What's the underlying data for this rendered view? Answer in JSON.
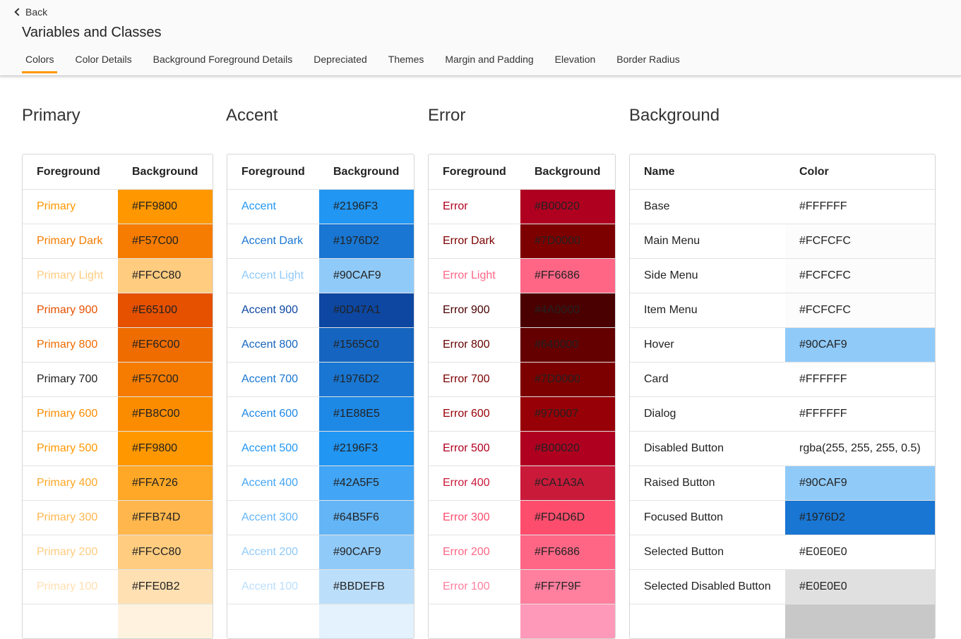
{
  "back_label": "Back",
  "page_title": "Variables and Classes",
  "tabs": [
    "Colors",
    "Color Details",
    "Background Foreground Details",
    "Depreciated",
    "Themes",
    "Margin and Padding",
    "Elevation",
    "Border Radius"
  ],
  "active_tab": "Colors",
  "tables": [
    {
      "id": "primary",
      "title": "Primary",
      "headers": [
        "Foreground",
        "Background"
      ],
      "rows": [
        {
          "name": "Primary",
          "value": "#FF9800",
          "name_color": "#FF9800",
          "bg": "#FF9800",
          "value_color": "#222222"
        },
        {
          "name": "Primary Dark",
          "value": "#F57C00",
          "name_color": "#F57C00",
          "bg": "#F57C00",
          "value_color": "#222222"
        },
        {
          "name": "Primary Light",
          "value": "#FFCC80",
          "name_color": "#FFCC80",
          "bg": "#FFCC80",
          "value_color": "#222222"
        },
        {
          "name": "Primary 900",
          "value": "#E65100",
          "name_color": "#E65100",
          "bg": "#E65100",
          "value_color": "#222222"
        },
        {
          "name": "Primary 800",
          "value": "#EF6C00",
          "name_color": "#EF6C00",
          "bg": "#EF6C00",
          "value_color": "#222222"
        },
        {
          "name": "Primary 700",
          "value": "#F57C00",
          "name_color": "#222222",
          "bg": "#F57C00",
          "value_color": "#222222"
        },
        {
          "name": "Primary 600",
          "value": "#FB8C00",
          "name_color": "#FB8C00",
          "bg": "#FB8C00",
          "value_color": "#222222"
        },
        {
          "name": "Primary 500",
          "value": "#FF9800",
          "name_color": "#FF9800",
          "bg": "#FF9800",
          "value_color": "#222222"
        },
        {
          "name": "Primary 400",
          "value": "#FFA726",
          "name_color": "#FFA726",
          "bg": "#FFA726",
          "value_color": "#222222"
        },
        {
          "name": "Primary 300",
          "value": "#FFB74D",
          "name_color": "#FFB74D",
          "bg": "#FFB74D",
          "value_color": "#222222"
        },
        {
          "name": "Primary 200",
          "value": "#FFCC80",
          "name_color": "#FFCC80",
          "bg": "#FFCC80",
          "value_color": "#222222"
        },
        {
          "name": "Primary 100",
          "value": "#FFE0B2",
          "name_color": "#FFE0B2",
          "bg": "#FFE0B2",
          "value_color": "#222222"
        },
        {
          "name": "",
          "value": "",
          "name_color": "#FFF3E0",
          "bg": "#FFF3E0",
          "value_color": "#222222"
        }
      ]
    },
    {
      "id": "accent",
      "title": "Accent",
      "headers": [
        "Foreground",
        "Background"
      ],
      "rows": [
        {
          "name": "Accent",
          "value": "#2196F3",
          "name_color": "#2196F3",
          "bg": "#2196F3",
          "value_color": "#222222"
        },
        {
          "name": "Accent Dark",
          "value": "#1976D2",
          "name_color": "#1976D2",
          "bg": "#1976D2",
          "value_color": "#222222"
        },
        {
          "name": "Accent Light",
          "value": "#90CAF9",
          "name_color": "#90CAF9",
          "bg": "#90CAF9",
          "value_color": "#222222"
        },
        {
          "name": "Accent 900",
          "value": "#0D47A1",
          "name_color": "#0D47A1",
          "bg": "#0D47A1",
          "value_color": "#222222"
        },
        {
          "name": "Accent 800",
          "value": "#1565C0",
          "name_color": "#1565C0",
          "bg": "#1565C0",
          "value_color": "#222222"
        },
        {
          "name": "Accent 700",
          "value": "#1976D2",
          "name_color": "#1976D2",
          "bg": "#1976D2",
          "value_color": "#222222"
        },
        {
          "name": "Accent 600",
          "value": "#1E88E5",
          "name_color": "#1E88E5",
          "bg": "#1E88E5",
          "value_color": "#222222"
        },
        {
          "name": "Accent 500",
          "value": "#2196F3",
          "name_color": "#2196F3",
          "bg": "#2196F3",
          "value_color": "#222222"
        },
        {
          "name": "Accent 400",
          "value": "#42A5F5",
          "name_color": "#42A5F5",
          "bg": "#42A5F5",
          "value_color": "#222222"
        },
        {
          "name": "Accent 300",
          "value": "#64B5F6",
          "name_color": "#64B5F6",
          "bg": "#64B5F6",
          "value_color": "#222222"
        },
        {
          "name": "Accent 200",
          "value": "#90CAF9",
          "name_color": "#90CAF9",
          "bg": "#90CAF9",
          "value_color": "#222222"
        },
        {
          "name": "Accent 100",
          "value": "#BBDEFB",
          "name_color": "#BBDEFB",
          "bg": "#BBDEFB",
          "value_color": "#222222"
        },
        {
          "name": "",
          "value": "",
          "name_color": "#E3F2FD",
          "bg": "#E3F2FD",
          "value_color": "#222222"
        }
      ]
    },
    {
      "id": "error",
      "title": "Error",
      "headers": [
        "Foreground",
        "Background"
      ],
      "rows": [
        {
          "name": "Error",
          "value": "#B00020",
          "name_color": "#B00020",
          "bg": "#B00020",
          "value_color": "#222222"
        },
        {
          "name": "Error Dark",
          "value": "#7D0000",
          "name_color": "#7D0000",
          "bg": "#7D0000",
          "value_color": "#222222"
        },
        {
          "name": "Error Light",
          "value": "#FF6686",
          "name_color": "#FF6686",
          "bg": "#FF6686",
          "value_color": "#222222"
        },
        {
          "name": "Error 900",
          "value": "#4A0000",
          "name_color": "#4A0000",
          "bg": "#4A0000",
          "value_color": "#222222"
        },
        {
          "name": "Error 800",
          "value": "#640000",
          "name_color": "#640000",
          "bg": "#640000",
          "value_color": "#222222"
        },
        {
          "name": "Error 700",
          "value": "#7D0000",
          "name_color": "#7D0000",
          "bg": "#7D0000",
          "value_color": "#222222"
        },
        {
          "name": "Error 600",
          "value": "#970007",
          "name_color": "#970007",
          "bg": "#970007",
          "value_color": "#222222"
        },
        {
          "name": "Error 500",
          "value": "#B00020",
          "name_color": "#B00020",
          "bg": "#B00020",
          "value_color": "#222222"
        },
        {
          "name": "Error 400",
          "value": "#CA1A3A",
          "name_color": "#CA1A3A",
          "bg": "#CA1A3A",
          "value_color": "#222222"
        },
        {
          "name": "Error 300",
          "value": "#FD4D6D",
          "name_color": "#FD4D6D",
          "bg": "#FD4D6D",
          "value_color": "#222222"
        },
        {
          "name": "Error 200",
          "value": "#FF6686",
          "name_color": "#FF6686",
          "bg": "#FF6686",
          "value_color": "#222222"
        },
        {
          "name": "Error 100",
          "value": "#FF7F9F",
          "name_color": "#FF7F9F",
          "bg": "#FF7F9F",
          "value_color": "#222222"
        },
        {
          "name": "",
          "value": "",
          "name_color": "#FF99B9",
          "bg": "#FF99B9",
          "value_color": "#222222"
        }
      ]
    },
    {
      "id": "background",
      "title": "Background",
      "headers": [
        "Name",
        "Color"
      ],
      "rows": [
        {
          "name": "Base",
          "value": "#FFFFFF",
          "name_color": "#222222",
          "bg": "#FFFFFF",
          "value_color": "#222222"
        },
        {
          "name": "Main Menu",
          "value": "#FCFCFC",
          "name_color": "#222222",
          "bg": "#FCFCFC",
          "value_color": "#222222"
        },
        {
          "name": "Side Menu",
          "value": "#FCFCFC",
          "name_color": "#222222",
          "bg": "#FCFCFC",
          "value_color": "#222222"
        },
        {
          "name": "Item Menu",
          "value": "#FCFCFC",
          "name_color": "#222222",
          "bg": "#FCFCFC",
          "value_color": "#222222"
        },
        {
          "name": "Hover",
          "value": "#90CAF9",
          "name_color": "#222222",
          "bg": "#90CAF9",
          "value_color": "#222222"
        },
        {
          "name": "Card",
          "value": "#FFFFFF",
          "name_color": "#222222",
          "bg": "#FFFFFF",
          "value_color": "#222222"
        },
        {
          "name": "Dialog",
          "value": "#FFFFFF",
          "name_color": "#222222",
          "bg": "#FFFFFF",
          "value_color": "#222222"
        },
        {
          "name": "Disabled Button",
          "value": "rgba(255, 255, 255, 0.5)",
          "name_color": "#222222",
          "bg": "#FFFFFF",
          "value_color": "#222222"
        },
        {
          "name": "Raised Button",
          "value": "#90CAF9",
          "name_color": "#222222",
          "bg": "#90CAF9",
          "value_color": "#222222"
        },
        {
          "name": "Focused Button",
          "value": "#1976D2",
          "name_color": "#222222",
          "bg": "#1976D2",
          "value_color": "#222222"
        },
        {
          "name": "Selected Button",
          "value": "#E0E0E0",
          "name_color": "#222222",
          "bg": "#FFFFFF",
          "value_color": "#222222"
        },
        {
          "name": "Selected Disabled Button",
          "value": "#E0E0E0",
          "name_color": "#222222",
          "bg": "#E0E0E0",
          "value_color": "#222222"
        },
        {
          "name": "",
          "value": "",
          "name_color": "#222222",
          "bg": "#C8C8C8",
          "value_color": "#222222"
        }
      ]
    }
  ]
}
